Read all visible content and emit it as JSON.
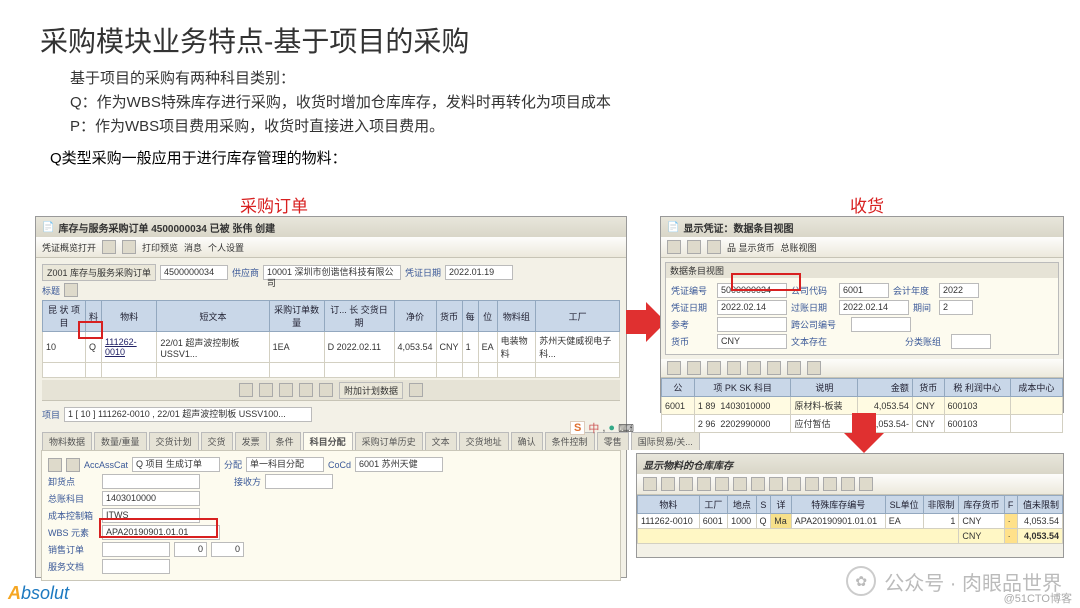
{
  "slide": {
    "title": "采购模块业务特点-基于项目的采购",
    "intro": "基于项目的采购有两种科目类别：",
    "lineQ": "Q：作为WBS特殊库存进行采购，收货时增加仓库库存，发料时再转化为项目成本",
    "lineP": "P：作为WBS项目费用采购，收货时直接进入项目费用。",
    "sub": "Q类型采购一般应用于进行库存管理的物料："
  },
  "labels": {
    "po": "采购订单",
    "gr": "收货"
  },
  "po": {
    "title": "库存与服务采购订单 4500000034 已被 张伟 创建",
    "toolbar": "凭证概览打开",
    "type": "Z001 库存与服务采购订单",
    "ponum": "4500000034",
    "vendorLabel": "供应商",
    "vendor": "10001 深圳市创谐信科技有限公司",
    "dateLabel": "凭证日期",
    "date": "2022.01.19",
    "cancel": "消息",
    "personal": "个人设置",
    "tool2": "打印预览",
    "gridHead": [
      "昆 状 项目",
      "料",
      "物料",
      "短文本",
      "采购订单数量",
      "订... 长 交货日期",
      "净价",
      "货币",
      "每",
      "位",
      "物料组",
      "工厂"
    ],
    "row": {
      "pos": "10",
      "acct": "Q",
      "mat": "111262-0010",
      "txt": "22/01 超声波控制板 USSV1...",
      "qty": "1EA",
      "deldate": "D 2022.02.11",
      "price": "4,053.54",
      "curr": "CNY",
      "per": "1",
      "unit": "EA",
      "grp": "电装物料",
      "plant": "苏州天健威视电子科..."
    },
    "itemDetail": "1 [ 10 ] 111262-0010 , 22/01 超声波控制板 USSV100...",
    "tabs": [
      "物料数据",
      "数量/重量",
      "交货计划",
      "交货",
      "发票",
      "条件",
      "科目分配",
      "采购订单历史",
      "文本",
      "交货地址",
      "确认",
      "条件控制",
      "零售",
      "国际贸易/关..."
    ],
    "accAss": "AccAssCat",
    "accVal": "Q 项目 生成订单",
    "dist": "分配",
    "distVal": "单一科目分配",
    "coCd": "CoCd",
    "coCdVal": "6001 苏州天健",
    "unload": "卸货点",
    "recip": "接收方",
    "gl": "总账科目",
    "glVal": "1403010000",
    "co": "成本控制箱",
    "coVal": "ITWS",
    "wbs": "WBS 元素",
    "wbsVal": "APA20190901.01.01",
    "sd": "销售订单",
    "sd1": "0",
    "sd2": "0",
    "svc": "服务文档",
    "addBtn": "附加计划数据"
  },
  "doc": {
    "title": "显示凭证：数据条目视图",
    "btn1": "品 显示货币",
    "btn2": "总账视图",
    "box": "数据条目视图",
    "vLabel": "凭证编号",
    "v": "5000000034",
    "ccLabel": "公司代码",
    "cc": "6001",
    "fyLabel": "会计年度",
    "fy": "2022",
    "pdLabel": "凭证日期",
    "pd": "2022.02.14",
    "postLabel": "过账日期",
    "post": "2022.02.14",
    "perLabel": "期间",
    "per": "2",
    "refLabel": "参考",
    "ref": "",
    "xccLabel": "跨公司编号",
    "xcc": "",
    "curLabel": "货币",
    "cur": "CNY",
    "txtLabel": "文本存在",
    "txt": "",
    "lgLabel": "分类账组",
    "lg": "",
    "gridHead": [
      "公",
      "项 PK SK 科目",
      "说明",
      "金额",
      "货币",
      "税 利润中心",
      "成本中心"
    ],
    "rows": [
      {
        "co": "6001",
        "it": "1 89",
        "acc": "1403010000",
        "desc": "原材料-板装",
        "amt": "4,053.54",
        "cur": "CNY",
        "pc": "600103"
      },
      {
        "co": "",
        "it": "2 96",
        "acc": "2202990000",
        "desc": "应付暂估",
        "amt": "4,053.54-",
        "cur": "CNY",
        "pc": "600103"
      }
    ]
  },
  "stock": {
    "title": "显示物料的仓库库存",
    "gridHead": [
      "物料",
      "工厂",
      "地点",
      "S",
      "详",
      "特殊库存编号",
      "SL单位",
      "非限制",
      "库存货币",
      "F",
      "值未限制"
    ],
    "rows": [
      {
        "mat": "111262-0010",
        "plant": "6001",
        "loc": "1000",
        "s": "Q",
        "btn": "Ma",
        "sp": "APA20190901.01.01",
        "unit": "EA",
        "qty": "1",
        "cur": "CNY",
        "val": "4,053.54"
      },
      {
        "mat": "",
        "plant": "",
        "loc": "",
        "s": "",
        "btn": "",
        "sp": "",
        "unit": "",
        "qty": "",
        "cur": "CNY",
        "val": "4,053.54"
      }
    ]
  },
  "watermark": "公众号 · 肉眼品世界",
  "blog": "@51CTO博客"
}
